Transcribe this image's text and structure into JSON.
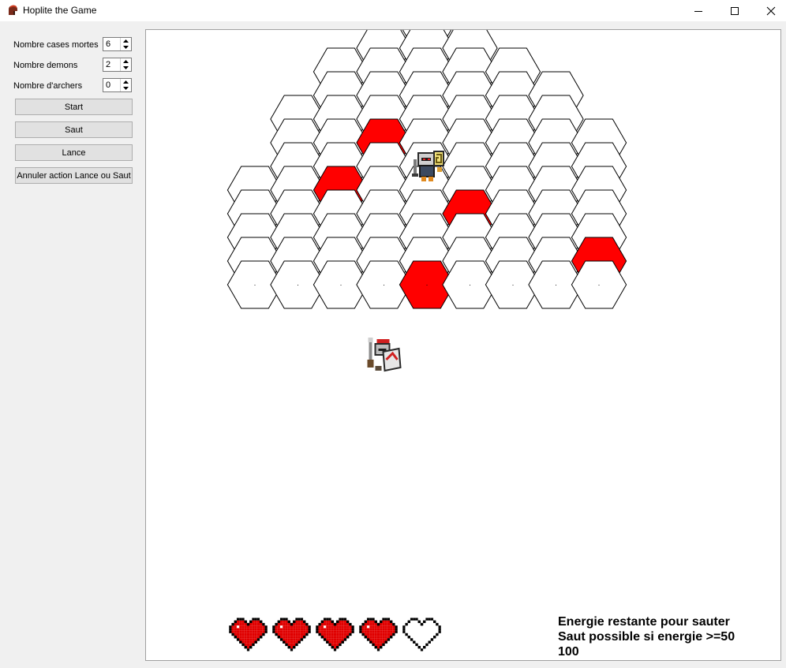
{
  "window": {
    "title": "Hoplite the Game",
    "controls": [
      "minimize",
      "maximize",
      "close"
    ]
  },
  "settings": [
    {
      "label": "Nombre cases mortes",
      "value": "6"
    },
    {
      "label": "Nombre demons",
      "value": "2"
    },
    {
      "label": "Nombre d'archers",
      "value": "0"
    }
  ],
  "buttons": {
    "start": "Start",
    "saut": "Saut",
    "lance": "Lance",
    "annuler": "Annuler action Lance ou Saut"
  },
  "board": {
    "columns": 9,
    "column_rows": [
      5,
      8,
      10,
      11,
      12,
      11,
      10,
      9,
      7
    ],
    "cell_marker": ".",
    "dead_cells": [
      [
        3,
        3
      ],
      [
        2,
        5
      ],
      [
        5,
        6
      ],
      [
        8,
        8
      ],
      [
        4,
        9
      ],
      [
        2,
        15
      ]
    ],
    "demon": {
      "col": 4,
      "row": 4,
      "icon": "demon-knight-sprite"
    },
    "player": {
      "col": 3,
      "row": 12,
      "icon": "hoplite-warrior-sprite"
    },
    "colors": {
      "dead": "#ff0000",
      "cell": "#ffffff",
      "border": "#000000"
    }
  },
  "health": {
    "max": 5,
    "current": 4,
    "icon": "pixel-heart-icon",
    "color": "#e00000"
  },
  "energy": {
    "line1": "Energie restante pour sauter",
    "line2": "Saut possible si energie >=50",
    "value": "100"
  }
}
